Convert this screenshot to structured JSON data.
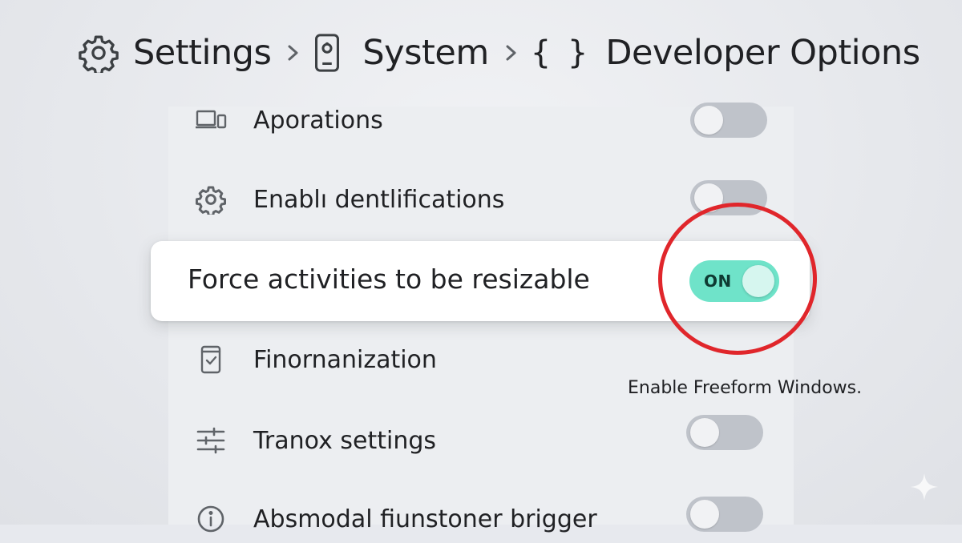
{
  "breadcrumb": {
    "items": [
      {
        "label": "Settings",
        "icon": "gear-icon"
      },
      {
        "label": "System",
        "icon": "phone-icon"
      },
      {
        "label": "Developer Options",
        "icon": "braces-icon",
        "icon_text": "{ }"
      }
    ],
    "separator": "chevron-right-icon"
  },
  "settings": {
    "rows": [
      {
        "label": "Aporations",
        "icon": "devices-icon",
        "toggle": "off"
      },
      {
        "label": "Enablı dentlifications",
        "icon": "gear-icon",
        "toggle": "off"
      },
      {
        "label": "Finornanization",
        "icon": "phone-check-icon",
        "toggle": null
      },
      {
        "label": "Tranox settings",
        "icon": "sliders-icon",
        "toggle": "off"
      },
      {
        "label": "Absmodal fiunstoner brigger",
        "icon": "info-icon",
        "toggle": "off"
      }
    ],
    "highlighted": {
      "label": "Force activities to be resizable",
      "toggle_text": "ON",
      "toggle_state": "on"
    },
    "caption": "Enable Freeform Windows."
  },
  "colors": {
    "background": "#e7e9ee",
    "toggle_on": "#6fe3c9",
    "toggle_off": "#bfc3ca",
    "annotation_circle": "#e0262b"
  }
}
